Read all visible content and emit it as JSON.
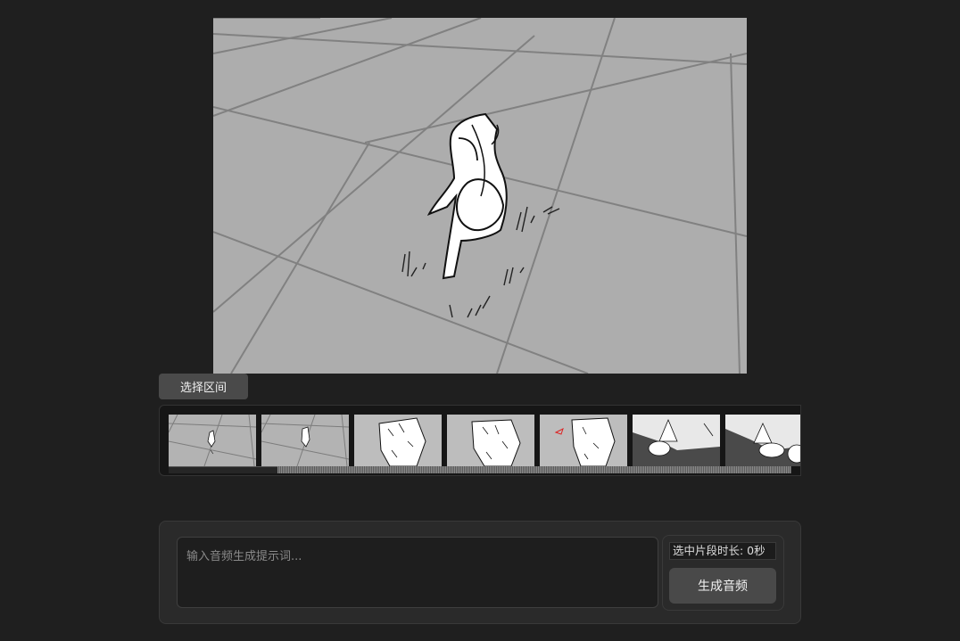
{
  "preview": {
    "alt_description": "sketched character walking on grey tiled floor"
  },
  "timeline": {
    "range_button_label": "选择区间",
    "frames": [
      {
        "kind": "floor-small-figure"
      },
      {
        "kind": "floor-small-figure"
      },
      {
        "kind": "closeup-sketch"
      },
      {
        "kind": "closeup-sketch"
      },
      {
        "kind": "closeup-sketch-red-mark"
      },
      {
        "kind": "dark-scene"
      },
      {
        "kind": "dark-scene"
      }
    ]
  },
  "generator": {
    "prompt_placeholder": "输入音频生成提示词...",
    "prompt_value": "",
    "duration_label": "选中片段时长: 0秒",
    "generate_label": "生成音频"
  },
  "colors": {
    "background": "#1f1f1f",
    "panel": "#2a2a2a",
    "button": "#494949",
    "preview_floor": "#adadad"
  }
}
